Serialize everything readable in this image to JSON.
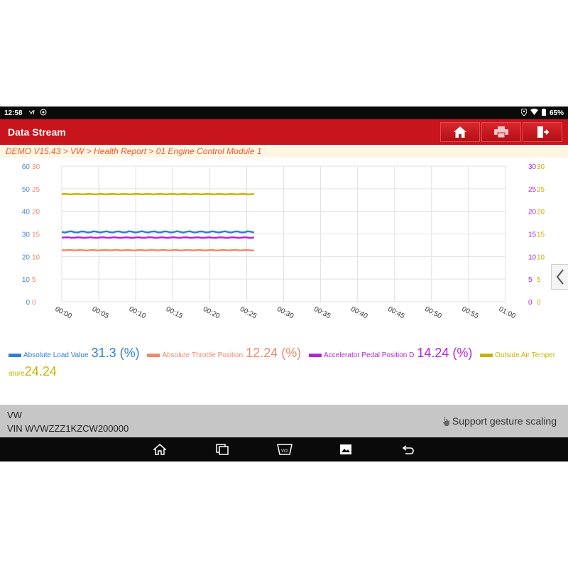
{
  "status_bar": {
    "time": "12:58",
    "battery": "65%"
  },
  "header": {
    "title": "Data Stream",
    "buttons": [
      "home",
      "print",
      "exit"
    ]
  },
  "breadcrumb": "DEMO V15.43 > VW > Health Report > 01 Engine Control Module 1",
  "chart_data": {
    "type": "line",
    "x_ticks": [
      "00:00",
      "00:05",
      "00:10",
      "00:15",
      "00:20",
      "00:25",
      "00:30",
      "00:35",
      "00:40",
      "00:45",
      "00:50",
      "00:55",
      "01:00"
    ],
    "left_axis_blue": [
      "60",
      "50",
      "40",
      "30",
      "20",
      "10",
      "0"
    ],
    "left_axis_orange": [
      "30",
      "25",
      "20",
      "15",
      "10",
      "5",
      "0"
    ],
    "right_axis_purple": [
      "30",
      "25",
      "20",
      "15",
      "10",
      "5",
      "0"
    ],
    "right_axis_yellow": [
      "30",
      "25",
      "20",
      "15",
      "10",
      "5",
      "0"
    ],
    "x_range_seconds": [
      0,
      60
    ],
    "series": [
      {
        "name": "Absolute Load Value",
        "unit": "(%)",
        "current": "31.3",
        "color": "#2e7fd6",
        "axis_max": 60,
        "level": 30.9,
        "end_seconds": 26
      },
      {
        "name": "Absolute Throttle Position",
        "unit": "(%)",
        "current": "12.24",
        "color": "#f0896a",
        "axis_max": 30,
        "level": 11.4,
        "end_seconds": 26
      },
      {
        "name": "Accelerator Pedal Position D",
        "unit": "(%)",
        "current": "14.24",
        "color": "#b325d8",
        "axis_max": 30,
        "level": 14.2,
        "end_seconds": 26
      },
      {
        "name": "Outside Air Temperature",
        "legend_line1": "Outside Air Temper",
        "legend_line2": "ature",
        "unit": "",
        "current": "24.24",
        "color": "#c9b200",
        "axis_max": 30,
        "level": 23.8,
        "end_seconds": 26
      }
    ],
    "grid": true
  },
  "legend": {
    "load_label": "Absolute Load Value",
    "load_value": "31.3",
    "load_unit": "(%)",
    "throttle_label": "Absolute Throttle Position",
    "throttle_value": "12.24",
    "throttle_unit": "(%)",
    "pedal_label": "Accelerator Pedal Position D",
    "pedal_value": "14.24",
    "pedal_unit": "(%)",
    "air_label_a": "Outside Air Temper",
    "air_label_b": "ature",
    "air_value": "24.24"
  },
  "footer": {
    "make": "VW",
    "vin": "VIN WVWZZZ1KZCW200000",
    "gesture_hint": "Support gesture scaling"
  },
  "nav": {
    "vci_label": "VCI"
  }
}
